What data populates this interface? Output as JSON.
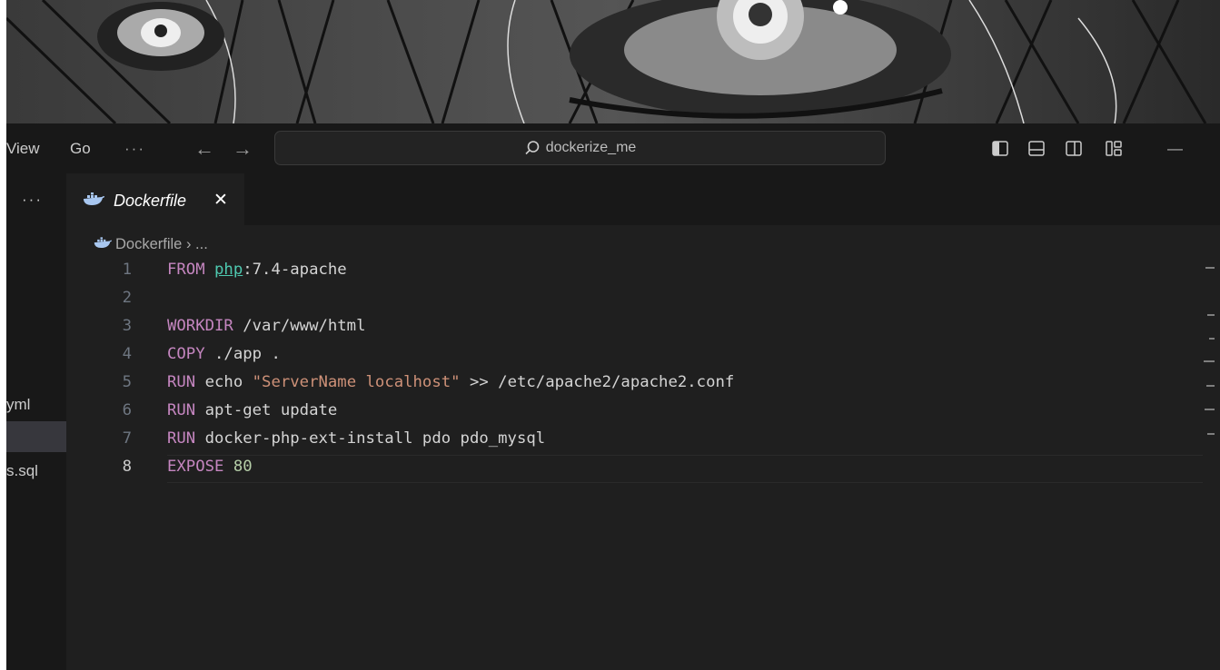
{
  "titlebar": {
    "menu": [
      "View",
      "Go",
      "···"
    ],
    "search_text": "dockerize_me",
    "minimize": "—"
  },
  "sidebar": {
    "more": "···",
    "files": [
      "yml",
      "s.sql"
    ]
  },
  "tab": {
    "label": "Dockerfile",
    "close": "✕"
  },
  "breadcrumb": {
    "file": "Dockerfile",
    "sep": "›",
    "rest": "..."
  },
  "editor": {
    "active_line": 8,
    "lines": [
      {
        "n": "1",
        "tokens": [
          [
            "kw",
            "FROM "
          ],
          [
            "img",
            "php"
          ],
          [
            "plain",
            ":7.4-apache"
          ]
        ]
      },
      {
        "n": "2",
        "tokens": []
      },
      {
        "n": "3",
        "tokens": [
          [
            "kw",
            "WORKDIR "
          ],
          [
            "plain",
            "/var/www/html"
          ]
        ]
      },
      {
        "n": "4",
        "tokens": [
          [
            "kw",
            "COPY "
          ],
          [
            "plain",
            "./app ."
          ]
        ]
      },
      {
        "n": "5",
        "tokens": [
          [
            "kw",
            "RUN "
          ],
          [
            "plain",
            "echo "
          ],
          [
            "str",
            "\"ServerName localhost\""
          ],
          [
            "plain",
            " >> /etc/apache2/apache2.conf"
          ]
        ]
      },
      {
        "n": "6",
        "tokens": [
          [
            "kw",
            "RUN "
          ],
          [
            "plain",
            "apt-get update"
          ]
        ]
      },
      {
        "n": "7",
        "tokens": [
          [
            "kw",
            "RUN "
          ],
          [
            "plain",
            "docker-php-ext-install pdo pdo_mysql"
          ]
        ]
      },
      {
        "n": "8",
        "tokens": [
          [
            "kw",
            "EXPOSE "
          ],
          [
            "num",
            "80"
          ]
        ]
      }
    ]
  },
  "colors": {
    "editor_bg": "#1f1f1f",
    "keyword": "#c586c0",
    "string": "#ce9178",
    "number": "#b5cea8",
    "image": "#4ec9b0",
    "text": "#d4d4d4",
    "docker_icon": "#a8c7f0"
  }
}
